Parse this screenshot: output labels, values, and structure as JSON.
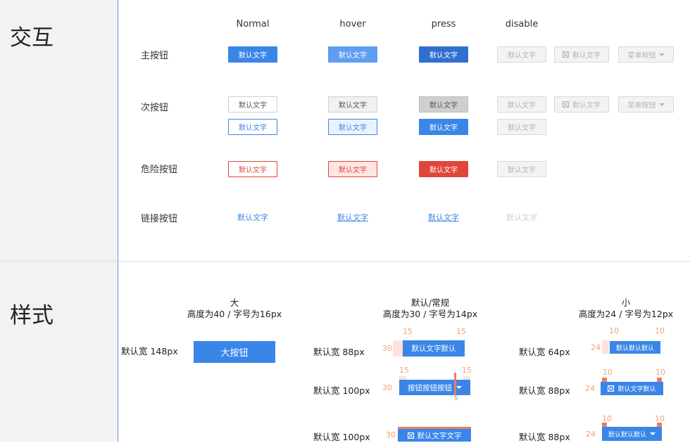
{
  "sections": {
    "interaction": "交互",
    "style": "样式"
  },
  "columns": {
    "normal": "Normal",
    "hover": "hover",
    "press": "press",
    "disable": "disable"
  },
  "rows": {
    "primary": "主按钮",
    "secondary": "次按钮",
    "danger": "危险按钮",
    "link": "链接按钮"
  },
  "button_text": "默认文字",
  "menu_button_text": "菜单按钮",
  "groups": {
    "large": {
      "title": "大",
      "subtitle": "高度为40  / 字号为16px"
    },
    "default": {
      "title": "默认/常规",
      "subtitle": "高度为30  / 字号为14px"
    },
    "small": {
      "title": "小",
      "subtitle": "高度为24 / 字号为12px"
    }
  },
  "large_width_label": "默认宽 148px",
  "large_button_text": "大按钮",
  "default_specs": [
    {
      "width_label": "默认宽 88px",
      "height": "30",
      "pad_left": "15",
      "pad_right": "15",
      "text": "默认文字默认"
    },
    {
      "width_label": "默认宽 100px",
      "height": "30",
      "pad_left": "15",
      "pad_right": "15",
      "text": "按钮按钮按钮",
      "gap": "5"
    },
    {
      "width_label": "默认宽 100px",
      "height": "30",
      "text": "默认文字文字"
    }
  ],
  "small_specs": [
    {
      "width_label": "默认宽 64px",
      "height": "24",
      "pad_left": "10",
      "pad_right": "10",
      "text": "默认默认默认"
    },
    {
      "width_label": "默认宽 88px",
      "height": "24",
      "pad_left": "10",
      "pad_right": "10",
      "text": "默认文字默认"
    },
    {
      "width_label": "默认宽 88px",
      "height": "24",
      "pad_left": "10",
      "pad_right": "10",
      "text": "默认默认默认"
    }
  ],
  "colors": {
    "primary": "#3a86e8",
    "danger": "#e0453a",
    "disabled": "#f3f3f3",
    "spec_annotation": "#f0a46e",
    "divider": "#5b95e0"
  },
  "icons": [
    "close-box-icon",
    "caret-down-icon"
  ]
}
